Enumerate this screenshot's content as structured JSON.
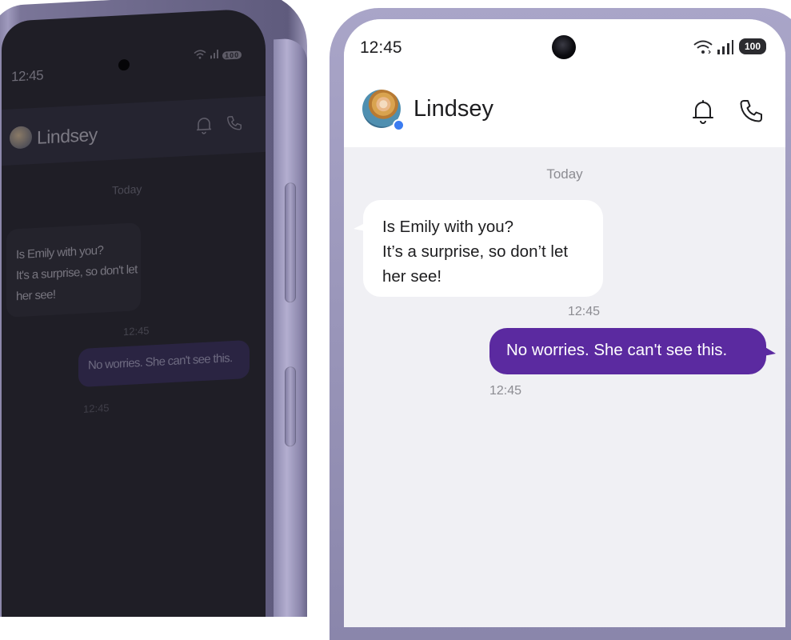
{
  "colors": {
    "accent_outgoing_bubble": "#5b2aa0",
    "incoming_bubble": "#ffffff",
    "chat_background": "#f0f0f4",
    "phone_frame": "#9c97b8",
    "online_indicator": "#3b7cf1"
  },
  "privacy_phone": {
    "status_bar": {
      "time": "12:45",
      "battery": "100"
    },
    "header": {
      "contact_name": "Lindsey",
      "icons": [
        "bell-icon",
        "phone-icon"
      ]
    },
    "date_separator": "Today",
    "messages": [
      {
        "direction": "incoming",
        "lines": [
          "Is Emily with you?",
          "It's a surprise, so don't let",
          "her see!"
        ],
        "time": "12:45"
      },
      {
        "direction": "outgoing",
        "text": "No worries. She can't see this.",
        "time": "12:45"
      }
    ]
  },
  "front_phone": {
    "status_bar": {
      "time": "12:45",
      "battery": "100",
      "icons": [
        "wifi-icon",
        "signal-icon"
      ]
    },
    "header": {
      "contact_name": "Lindsey",
      "icons": [
        "bell-icon",
        "phone-icon"
      ]
    },
    "date_separator": "Today",
    "messages": [
      {
        "direction": "incoming",
        "lines": [
          "Is Emily with you?",
          "It’s a surprise, so don’t let",
          "her see!"
        ],
        "time": "12:45"
      },
      {
        "direction": "outgoing",
        "text": "No worries. She can't see this.",
        "time": "12:45"
      }
    ]
  }
}
